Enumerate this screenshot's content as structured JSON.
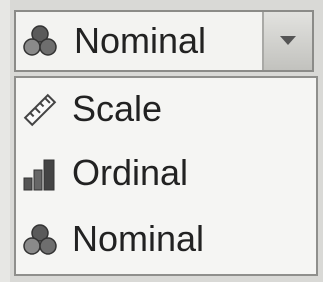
{
  "select": {
    "value": "Nominal",
    "icon": "nominal-icon"
  },
  "options": [
    {
      "label": "Scale",
      "icon": "scale-icon"
    },
    {
      "label": "Ordinal",
      "icon": "ordinal-icon"
    },
    {
      "label": "Nominal",
      "icon": "nominal-icon"
    }
  ],
  "colors": {
    "background": "#d9d9d6",
    "field": "#f3f3f1",
    "text": "#222222"
  }
}
